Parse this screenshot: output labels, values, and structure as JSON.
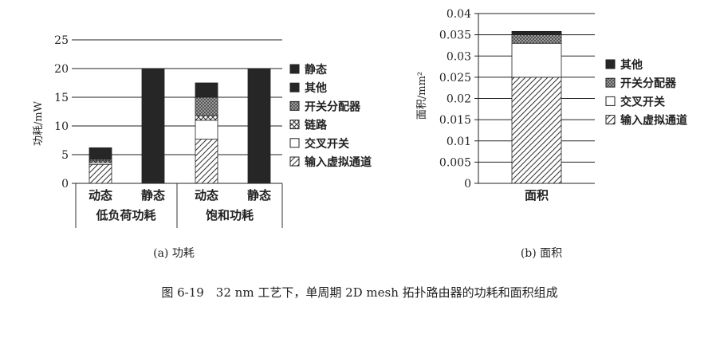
{
  "caption": "图 6-19　32 nm 工艺下，单周期 2D mesh 拓扑路由器的功耗和面积组成",
  "chart_data": [
    {
      "type": "bar",
      "subcaption": "(a)  功耗",
      "ylabel": "功耗/mW",
      "ylim": [
        0,
        25
      ],
      "yticks": [
        "0",
        "5",
        "10",
        "15",
        "20",
        "25"
      ],
      "categories": [
        "动态",
        "静态",
        "动态",
        "静态"
      ],
      "groups": [
        "低负荷功耗",
        "饱和功耗"
      ],
      "series": [
        {
          "name": "输入虚拟通道",
          "values": [
            3.3,
            0,
            7.7,
            0
          ],
          "fill": "hatch",
          "color": "#222222"
        },
        {
          "name": "交叉开关",
          "values": [
            0.3,
            0,
            3.3,
            0
          ],
          "fill": "white",
          "color": "#ffffff"
        },
        {
          "name": "链路",
          "values": [
            0.3,
            0,
            0.8,
            0
          ],
          "fill": "xhatch",
          "color": "#333333"
        },
        {
          "name": "开关分配器",
          "values": [
            0.3,
            0,
            3.2,
            0
          ],
          "fill": "check",
          "color": "#777777"
        },
        {
          "name": "其他",
          "values": [
            2.0,
            0,
            2.5,
            0
          ],
          "fill": "solid",
          "color": "#262626"
        },
        {
          "name": "静态",
          "values": [
            0,
            20.0,
            0,
            20.0
          ],
          "fill": "solid",
          "color": "#262626"
        }
      ],
      "legend": [
        "静态",
        "其他",
        "开关分配器",
        "链路",
        "交叉开关",
        "输入虚拟通道"
      ]
    },
    {
      "type": "bar",
      "subcaption": "(b)  面积",
      "ylabel": "面积/mm²",
      "ylim": [
        0,
        0.04
      ],
      "yticks": [
        "0",
        "0.005",
        "0.01",
        "0.015",
        "0.02",
        "0.025",
        "0.03",
        "0.035",
        "0.04"
      ],
      "categories": [
        "面积"
      ],
      "series": [
        {
          "name": "输入虚拟通道",
          "values": [
            0.025
          ],
          "fill": "hatch",
          "color": "#222222"
        },
        {
          "name": "交叉开关",
          "values": [
            0.008
          ],
          "fill": "white",
          "color": "#ffffff"
        },
        {
          "name": "开关分配器",
          "values": [
            0.002
          ],
          "fill": "check",
          "color": "#777777"
        },
        {
          "name": "其他",
          "values": [
            0.0008
          ],
          "fill": "solid",
          "color": "#262626"
        }
      ],
      "legend": [
        "其他",
        "开关分配器",
        "交叉开关",
        "输入虚拟通道"
      ]
    }
  ]
}
